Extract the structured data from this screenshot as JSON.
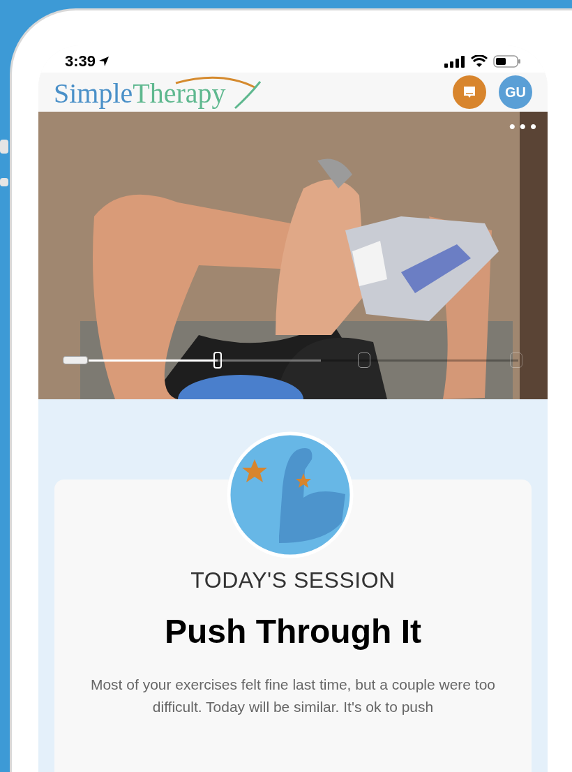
{
  "status_bar": {
    "time": "3:39"
  },
  "header": {
    "logo": [
      "Simple",
      "Therapy"
    ],
    "avatar": "GU"
  },
  "video": {
    "more": "•••",
    "progress": {
      "level": 0.3
    }
  },
  "session": {
    "eyebrow": "TODAY'S SESSION",
    "title": "Push Through It",
    "description": "Most of your exercises felt fine last time, but a couple were too difficult. Today will be similar. It's ok to push"
  }
}
